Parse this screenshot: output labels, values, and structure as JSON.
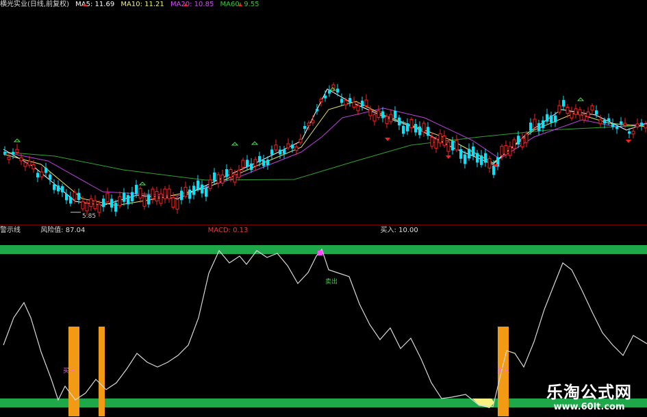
{
  "header": {
    "stock": "横光实业(日线,前复权)",
    "ma5_label": "MA5: 11.69",
    "ma10_label": "MA10: 11.21",
    "ma20_label": "MA20: 10.85",
    "ma60_label": "MA60: 9.55"
  },
  "indicator_header": {
    "name": "警示线",
    "risk_label": "风险值: 87.04",
    "macd_label": "MACD: 0.13",
    "buy_label": "买入: 10.00"
  },
  "price_chart": {
    "low_marker": "5.85"
  },
  "signals": {
    "sell_label": "卖出",
    "buy_label": "买入"
  },
  "watermark": {
    "brand": "乐淘公式网",
    "url": "www.60lt.com"
  },
  "colors": {
    "up": "#ff2020",
    "down": "#00e5ff",
    "ma5": "#ffffff",
    "ma10": "#e8e860",
    "ma20": "#c040e0",
    "ma60": "#2ea52e",
    "band": "#1fa84a",
    "bar": "#f39a14",
    "line": "#d8d8d8"
  }
}
